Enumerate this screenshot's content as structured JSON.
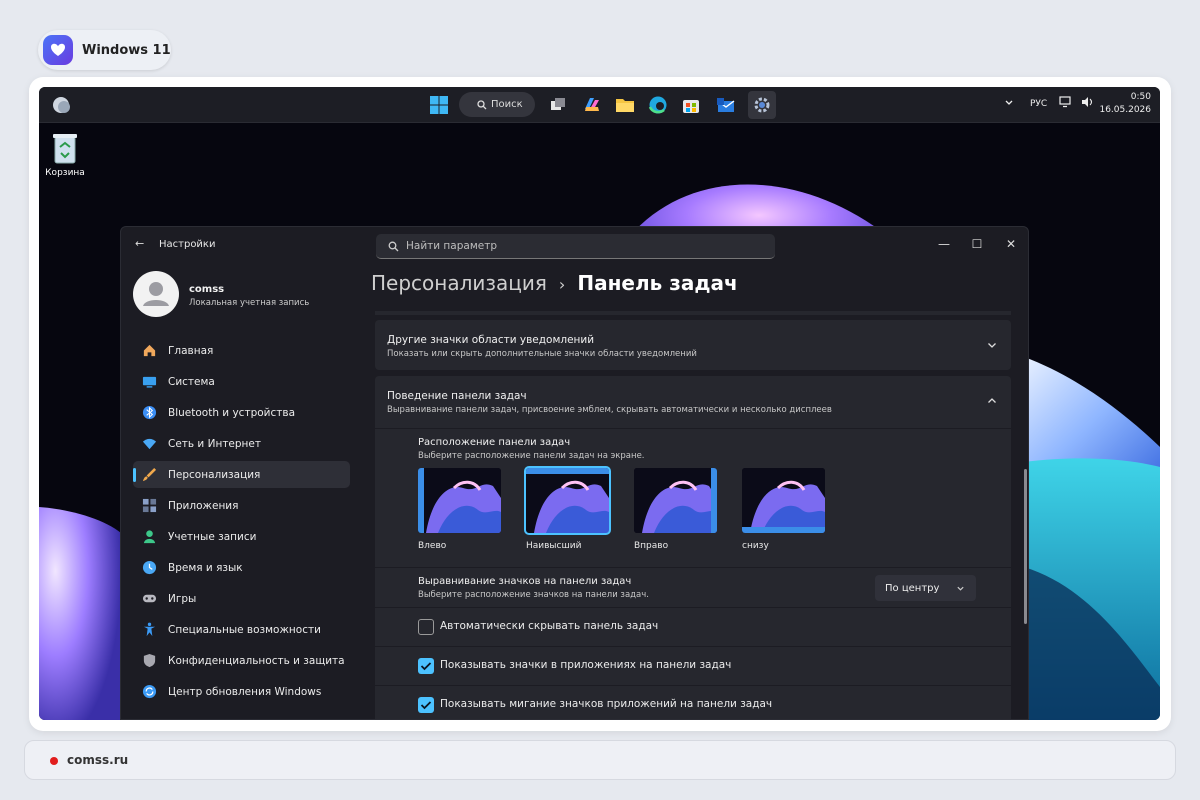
{
  "badge": {
    "title": "Windows 11"
  },
  "taskbar": {
    "search_label": "Поиск",
    "language": "РУС",
    "time": "0:50",
    "date": "16.05.2026"
  },
  "desktop": {
    "recycle_bin_label": "Корзина"
  },
  "settings": {
    "window_title": "Настройки",
    "search_placeholder": "Найти параметр",
    "user": {
      "name": "comss",
      "type": "Локальная учетная запись"
    },
    "breadcrumb": {
      "parent": "Персонализация",
      "separator": "›",
      "current": "Панель задач"
    },
    "nav": [
      {
        "label": "Главная",
        "icon": "home-icon",
        "color": "#f0a85c"
      },
      {
        "label": "Система",
        "icon": "monitor-icon",
        "color": "#39a0f0"
      },
      {
        "label": "Bluetooth и устройства",
        "icon": "bluetooth-icon",
        "color": "#3b8ef5"
      },
      {
        "label": "Сеть и Интернет",
        "icon": "wifi-icon",
        "color": "#4aa8f5"
      },
      {
        "label": "Персонализация",
        "icon": "brush-icon",
        "color": "#f0a84c"
      },
      {
        "label": "Приложения",
        "icon": "apps-icon",
        "color": "#8aa0c8"
      },
      {
        "label": "Учетные записи",
        "icon": "person-icon",
        "color": "#3dc88a"
      },
      {
        "label": "Время и язык",
        "icon": "globe-clock-icon",
        "color": "#4aa8f5"
      },
      {
        "label": "Игры",
        "icon": "gamepad-icon",
        "color": "#b8b8c0"
      },
      {
        "label": "Специальные возможности",
        "icon": "accessibility-icon",
        "color": "#3b9af5"
      },
      {
        "label": "Конфиденциальность и защита",
        "icon": "shield-icon",
        "color": "#a8a8b0"
      },
      {
        "label": "Центр обновления Windows",
        "icon": "update-icon",
        "color": "#3b9af5"
      }
    ],
    "active_nav_index": 4,
    "panels": {
      "other_icons": {
        "title": "Другие значки области уведомлений",
        "subtitle": "Показать или скрыть дополнительные значки области уведомлений"
      },
      "behavior": {
        "title": "Поведение панели задач",
        "subtitle": "Выравнивание панели задач, присвоение эмблем, скрывать автоматически и несколько дисплеев"
      }
    },
    "location": {
      "title": "Расположение панели задач",
      "subtitle": "Выберите расположение панели задач на экране.",
      "options": [
        "Влево",
        "Наивысший",
        "Вправо",
        "снизу"
      ],
      "selected_index": 1
    },
    "alignment": {
      "title": "Выравнивание значков на панели задач",
      "subtitle": "Выберите расположение значков на панели задач.",
      "value": "По центру"
    },
    "checkboxes": [
      {
        "label": "Автоматически скрывать панель задач",
        "checked": false
      },
      {
        "label": "Показывать значки в приложениях на панели задач",
        "checked": true
      },
      {
        "label": "Показывать мигание значков приложений на панели задач",
        "checked": true
      }
    ]
  },
  "footer": {
    "source": "comss.ru"
  },
  "colors": {
    "accent": "#4cc2ff",
    "window_bg": "#1c1c23",
    "panel_bg": "#26272e"
  }
}
